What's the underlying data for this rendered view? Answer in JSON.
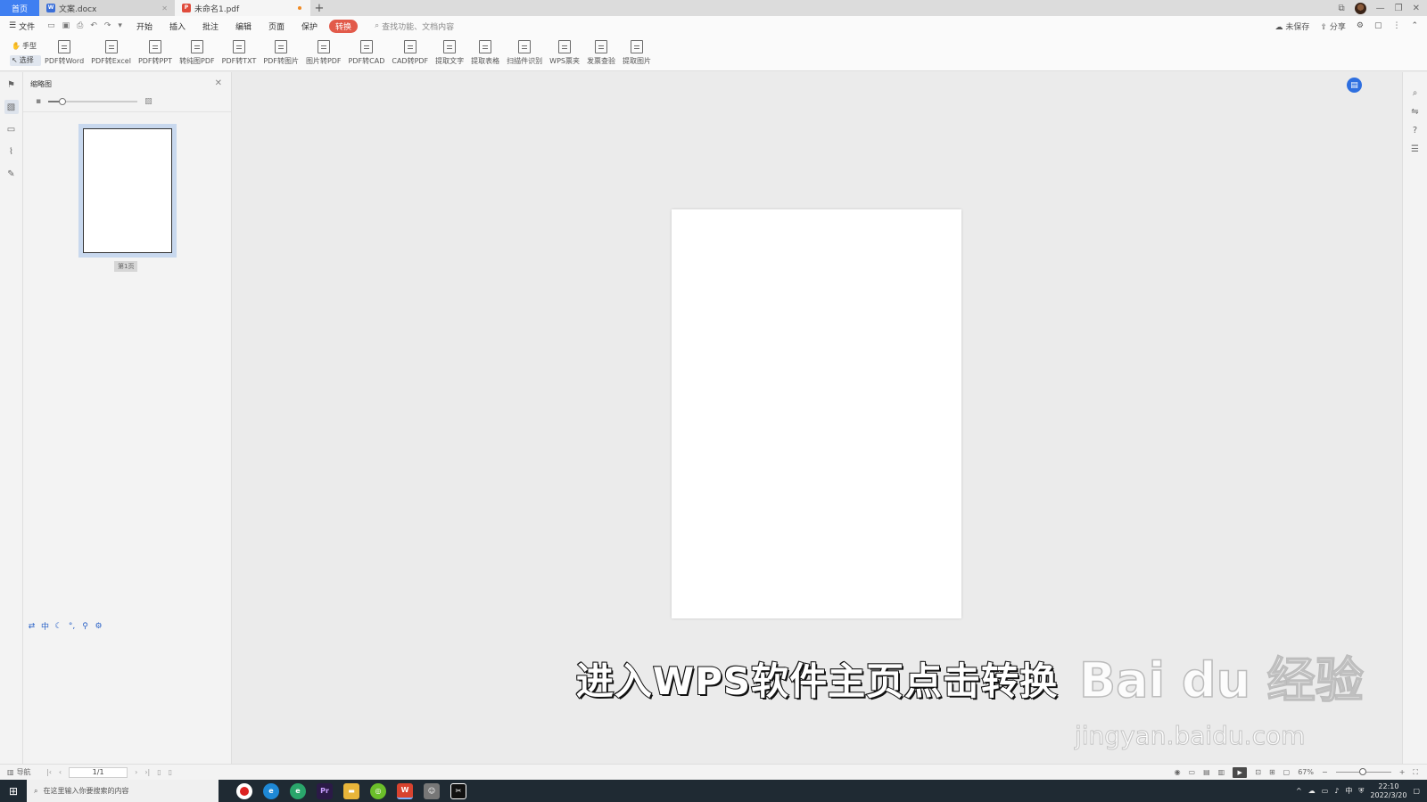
{
  "tabs": {
    "home": "首页",
    "doc1": "文案.docx",
    "doc2": "未命名1.pdf"
  },
  "menu": {
    "file": "文件",
    "items": [
      "开始",
      "插入",
      "批注",
      "编辑",
      "页面",
      "保护",
      "转换"
    ],
    "active_index": 6,
    "search_hint": "查找功能、文档内容",
    "unsaved": "未保存",
    "share": "分享"
  },
  "ribbon": {
    "modes": [
      "手型",
      "选择"
    ],
    "buttons": [
      "PDF转Word",
      "PDF转Excel",
      "PDF转PPT",
      "转纯图PDF",
      "PDF转TXT",
      "PDF转图片",
      "图片转PDF",
      "PDF转CAD",
      "CAD转PDF",
      "提取文字",
      "提取表格",
      "扫描件识别",
      "WPS票夹",
      "发票查验",
      "提取图片"
    ]
  },
  "thumbnail_panel": {
    "title": "缩略图",
    "page_label": "第1页"
  },
  "ime_bar": [
    "中"
  ],
  "statusbar": {
    "nav_label": "导航",
    "page_indicator": "1/1",
    "zoom": "67%"
  },
  "subtitle": "进入WPS软件主页点击转换",
  "watermark": {
    "logo": "Bai du 经验",
    "url": "jingyan.baidu.com"
  },
  "taskbar": {
    "search_placeholder": "在这里输入你要搜索的内容",
    "apps": [
      "Pr"
    ],
    "ime": "中",
    "time": "22:10",
    "date": "2022/3/20"
  },
  "colors": {
    "accent_blue": "#3f7ff1",
    "convert_red": "#e25a4a"
  }
}
